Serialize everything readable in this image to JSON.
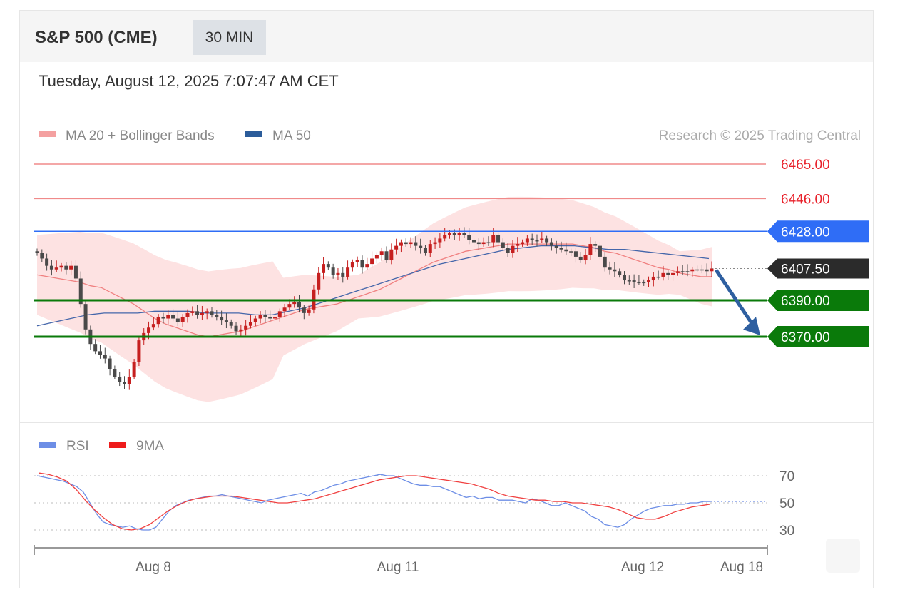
{
  "header": {
    "instrument": "S&P 500 (CME)",
    "interval": "30 MIN",
    "datetime": "Tuesday, August 12, 2025 7:07:47 AM CET"
  },
  "legend": {
    "ma20_bb": "MA 20 + Bollinger Bands",
    "ma50": "MA 50",
    "credit": "Research © 2025 Trading Central"
  },
  "rsi_legend": {
    "rsi": "RSI",
    "ma9": "9MA"
  },
  "colors": {
    "resistance": "#f08a8a",
    "resistance_text": "#e8202a",
    "pivot": "#2f6df6",
    "support": "#0a7a0a",
    "last_price": "#2b2b2b",
    "candle": "#4a4a4a",
    "candle_bull": "#c61f1f",
    "bollinger_fill": "#fde2e2",
    "ma20": "#f08080",
    "ma50": "#4466aa",
    "rsi": "#6d8ee6",
    "rsi_ma": "#f04040",
    "arrow": "#2e5fa0"
  },
  "chart_data": [
    {
      "type": "candlestick",
      "title": "S&P 500 (CME) 30 MIN",
      "x_ticks": [
        "Aug 8",
        "Aug 11",
        "Aug 12",
        "Aug 18"
      ],
      "ylim": [
        6330,
        6475
      ],
      "levels": [
        {
          "label": "6465.00",
          "value": 6465.0,
          "kind": "resistance"
        },
        {
          "label": "6446.00",
          "value": 6446.0,
          "kind": "resistance"
        },
        {
          "label": "6428.00",
          "value": 6428.0,
          "kind": "pivot"
        },
        {
          "label": "6407.50",
          "value": 6407.5,
          "kind": "last"
        },
        {
          "label": "6390.00",
          "value": 6390.0,
          "kind": "support"
        },
        {
          "label": "6370.00",
          "value": 6370.0,
          "kind": "support"
        }
      ],
      "forecast": {
        "from": 6407.5,
        "to": 6370.0,
        "direction": "down"
      },
      "close": [
        6416,
        6413,
        6409,
        6407,
        6408,
        6409,
        6407,
        6409,
        6402,
        6388,
        6374,
        6366,
        6362,
        6360,
        6358,
        6352,
        6348,
        6345,
        6344,
        6348,
        6356,
        6368,
        6372,
        6375,
        6377,
        6381,
        6380,
        6382,
        6380,
        6378,
        6381,
        6383,
        6384,
        6382,
        6383,
        6384,
        6382,
        6381,
        6379,
        6378,
        6376,
        6373,
        6374,
        6376,
        6378,
        6380,
        6382,
        6381,
        6380,
        6381,
        6384,
        6386,
        6388,
        6389,
        6386,
        6383,
        6385,
        6396,
        6405,
        6410,
        6408,
        6404,
        6405,
        6403,
        6408,
        6411,
        6412,
        6408,
        6410,
        6413,
        6415,
        6417,
        6412,
        6418,
        6420,
        6422,
        6421,
        6422,
        6420,
        6419,
        6416,
        6421,
        6422,
        6424,
        6426,
        6427,
        6426,
        6427,
        6426,
        6423,
        6422,
        6421,
        6422,
        6422,
        6426,
        6422,
        6419,
        6416,
        6420,
        6421,
        6422,
        6424,
        6423,
        6423,
        6424,
        6422,
        6420,
        6419,
        6418,
        6417,
        6417,
        6414,
        6412,
        6415,
        6421,
        6420,
        6414,
        6408,
        6407,
        6406,
        6404,
        6401,
        6401,
        6400,
        6400,
        6400,
        6401,
        6403,
        6403,
        6405,
        6404,
        6405,
        6406,
        6406,
        6406,
        6407,
        6407,
        6407,
        6406,
        6407.5
      ],
      "ma20": [
        6404,
        6403,
        6402,
        6401,
        6400,
        6398,
        6397,
        6394,
        6391,
        6388,
        6384,
        6380,
        6377,
        6375,
        6373,
        6371,
        6370,
        6371,
        6372,
        6373,
        6375,
        6377,
        6379,
        6381,
        6383,
        6385,
        6386,
        6387,
        6388,
        6390,
        6392,
        6394,
        6396,
        6399,
        6402,
        6405,
        6408,
        6411,
        6413,
        6415,
        6417,
        6418,
        6419,
        6420,
        6421,
        6421,
        6421,
        6421,
        6421,
        6421,
        6421,
        6420,
        6419,
        6417,
        6416,
        6414,
        6412,
        6410,
        6408,
        6407,
        6405,
        6404,
        6403,
        6403
      ],
      "ma50": [
        6376,
        6378,
        6380,
        6382,
        6383,
        6383,
        6383,
        6384,
        6384,
        6384,
        6383,
        6383,
        6383,
        6382,
        6382,
        6384,
        6386,
        6389,
        6392,
        6395,
        6398,
        6401,
        6404,
        6407,
        6410,
        6412,
        6414,
        6416,
        6418,
        6419,
        6420,
        6420,
        6420,
        6419,
        6418,
        6418,
        6417,
        6416,
        6415,
        6414,
        6413
      ],
      "ma50_end": 6413
    },
    {
      "type": "line",
      "title": "RSI",
      "ylim": [
        20,
        80
      ],
      "y_ticks": [
        "70",
        "50",
        "30"
      ],
      "series": [
        {
          "name": "RSI",
          "values": [
            70,
            69,
            68,
            67,
            66,
            64,
            62,
            58,
            50,
            42,
            36,
            34,
            33,
            32,
            33,
            31,
            30,
            30,
            32,
            38,
            44,
            48,
            50,
            52,
            53,
            54,
            55,
            55,
            56,
            55,
            54,
            53,
            52,
            51,
            50,
            52,
            53,
            54,
            55,
            56,
            57,
            55,
            58,
            59,
            61,
            63,
            64,
            66,
            67,
            68,
            69,
            70,
            71,
            70,
            70,
            68,
            66,
            64,
            63,
            63,
            62,
            62,
            60,
            58,
            56,
            54,
            55,
            53,
            54,
            54,
            52,
            52,
            52,
            51,
            50,
            53,
            52,
            50,
            48,
            48,
            50,
            48,
            46,
            44,
            40,
            38,
            34,
            33,
            32,
            34,
            38,
            41,
            44,
            46,
            47,
            48,
            48,
            49,
            49,
            50,
            50,
            51,
            51
          ]
        },
        {
          "name": "9MA",
          "values": [
            72,
            71,
            69,
            66,
            60,
            52,
            45,
            39,
            34,
            31,
            30,
            31,
            34,
            39,
            44,
            48,
            51,
            53,
            54,
            55,
            55,
            55,
            54,
            53,
            52,
            51,
            50,
            50,
            51,
            52,
            53,
            55,
            57,
            59,
            61,
            63,
            65,
            67,
            68,
            69,
            70,
            70,
            69,
            68,
            67,
            66,
            65,
            64,
            62,
            60,
            57,
            55,
            54,
            53,
            52,
            52,
            51,
            51,
            50,
            50,
            49,
            48,
            47,
            45,
            42,
            39,
            38,
            38,
            40,
            43,
            45,
            47,
            48,
            49
          ]
        }
      ]
    }
  ]
}
